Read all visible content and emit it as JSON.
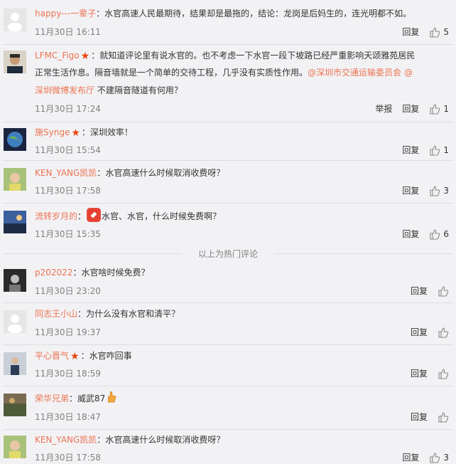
{
  "comments_top": [
    {
      "user": "happy---一辈子",
      "text": "：水官高速人民最期待，结果却是最拖的，结论：龙岗是后妈生的，连光明都不如。",
      "time": "11月30日 16:11",
      "reply": "回复",
      "likes": "5"
    },
    {
      "user": "LFMC_Figo",
      "line1": "：就知道评论里有说水官的。也不考虑一下水官一段下坡路已经严重影响天颂雅苑居民",
      "line2_pre": "正常生活作息。隔音墙就是一个简单的交待工程，几乎没有实质性作用。",
      "at1": "@深圳市交通运输委员会",
      "at2": "@",
      "line3_at": "深圳微博发布厅",
      "line3_text": " 不建隔音隧道有何用？",
      "time": "11月30日 17:24",
      "report": "举报",
      "reply": "回复",
      "likes": "1"
    },
    {
      "user": "施Synge",
      "text": "：深圳效率！",
      "time": "11月30日 15:54",
      "reply": "回复",
      "likes": "1"
    },
    {
      "user": "KEN_YANG凯凯",
      "text": "：水官高速什么时候取消收费呀？",
      "time": "11月30日 17:58",
      "reply": "回复",
      "likes": "3"
    },
    {
      "user": "流转岁月的",
      "text": "水官、水官，什么时候免费啊？",
      "time": "11月30日 15:35",
      "reply": "回复",
      "likes": "6"
    }
  ],
  "divider_text": "以上为热门评论",
  "comments_new": [
    {
      "user": "p202022",
      "text": "：水官啥时候免费？",
      "time": "11月30日 23:20",
      "reply": "回复"
    },
    {
      "user": "同志王小山",
      "text": "：为什么没有水官和清平？",
      "time": "11月30日 19:37",
      "reply": "回复"
    },
    {
      "user": "平心晋气",
      "text": "：水官咋回事",
      "time": "11月30日 18:59",
      "reply": "回复"
    },
    {
      "user": "荣华兄弟",
      "text": "：威武87",
      "time": "11月30日 18:47",
      "reply": "回复"
    },
    {
      "user": "KEN_YANG凯凯",
      "text": "：水官高速什么时候取消收费呀？",
      "time": "11月30日 17:58",
      "reply": "回复",
      "likes": "3"
    }
  ],
  "colors": {
    "username": "#eb7350",
    "background": "#f2f2f5",
    "time": "#808080",
    "star": "#e8430c"
  }
}
